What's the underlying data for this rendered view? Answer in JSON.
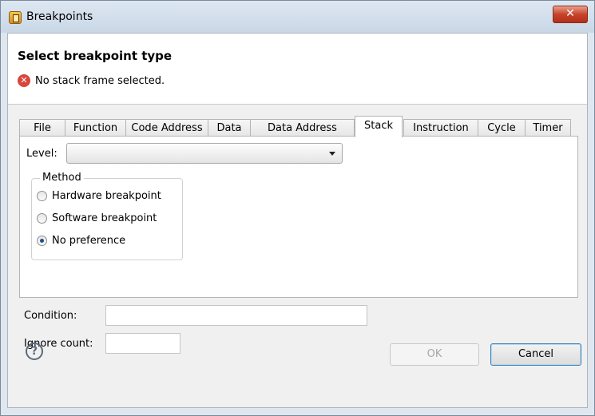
{
  "window": {
    "title": "Breakpoints",
    "close_label": "✕"
  },
  "header": {
    "title": "Select breakpoint type",
    "message": "No stack frame selected."
  },
  "tabs": [
    {
      "label": "File"
    },
    {
      "label": "Function"
    },
    {
      "label": "Code Address"
    },
    {
      "label": "Data"
    },
    {
      "label": "Data Address"
    },
    {
      "label": "Stack",
      "active": true
    },
    {
      "label": "Instruction"
    },
    {
      "label": "Cycle"
    },
    {
      "label": "Timer"
    }
  ],
  "stack_panel": {
    "level_label": "Level:",
    "level_value": "",
    "method": {
      "legend": "Method",
      "options": [
        {
          "label": "Hardware breakpoint",
          "checked": false
        },
        {
          "label": "Software breakpoint",
          "checked": false
        },
        {
          "label": "No preference",
          "checked": true
        }
      ]
    }
  },
  "condition": {
    "label": "Condition:",
    "value": ""
  },
  "ignore_count": {
    "label": "Ignore count:",
    "value": ""
  },
  "buttons": {
    "help": "?",
    "ok": "OK",
    "cancel": "Cancel"
  },
  "icons": {
    "app": "app-icon",
    "error": "error-icon",
    "help": "help-icon",
    "dropdown": "chevron-down-icon"
  },
  "colors": {
    "error": "#d9463c",
    "titlebar": "#c9d7e6",
    "close": "#c7432a"
  }
}
